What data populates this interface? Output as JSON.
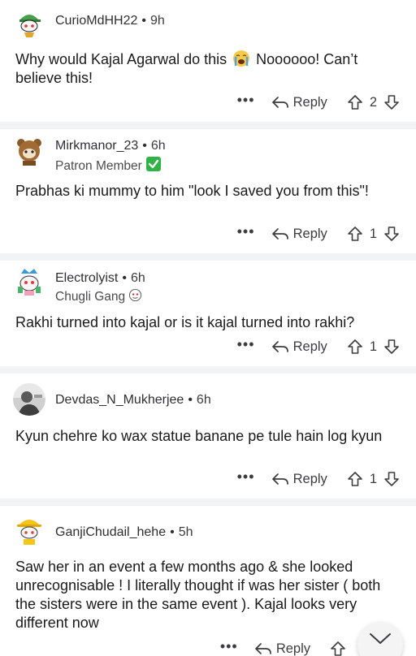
{
  "comments": [
    {
      "username": "CurioMdHH22",
      "time": "9h",
      "flair": "",
      "text_before": "Why would Kajal Agarwal do this",
      "text_after": "Noooooo! Can’t believe this!",
      "reply_label": "Reply",
      "votes": "2",
      "avatar_icon": "snoo-green-cap-avatar-icon"
    },
    {
      "username": "Mirkmanor_23",
      "time": "6h",
      "flair": "Patron Member",
      "text": "Prabhas ki mummy to him \"look I saved you from this\"!",
      "reply_label": "Reply",
      "votes": "1",
      "avatar_icon": "snoo-bear-costume-avatar-icon"
    },
    {
      "username": "Electrolyist",
      "time": "6h",
      "flair": "Chugli Gang",
      "text": "Rakhi turned into kajal or is it kajal turned into rakhi?",
      "reply_label": "Reply",
      "votes": "1",
      "avatar_icon": "snoo-crown-avatar-icon"
    },
    {
      "username": "Devdas_N_Mukherjee",
      "time": "6h",
      "flair": "",
      "text": "Kyun chehre ko wax statue banane pe tule hain log kyun",
      "reply_label": "Reply",
      "votes": "1",
      "avatar_icon": "photo-avatar-icon"
    },
    {
      "username": "GanjiChudail_hehe",
      "time": "5h",
      "flair": "",
      "text": "Saw her in an event a few months ago & she looked unrecognisable ! I literally thought if was her sister ( both the sisters were in the same event ). Kajal looks very different now",
      "reply_label": "Reply",
      "votes": "",
      "avatar_icon": "snoo-yellow-hat-avatar-icon"
    }
  ],
  "colors": {
    "text": "#1a1a1b",
    "muted": "#3c3d3e",
    "separator": "#f2f3f5",
    "flair_check": "#2fb344"
  }
}
